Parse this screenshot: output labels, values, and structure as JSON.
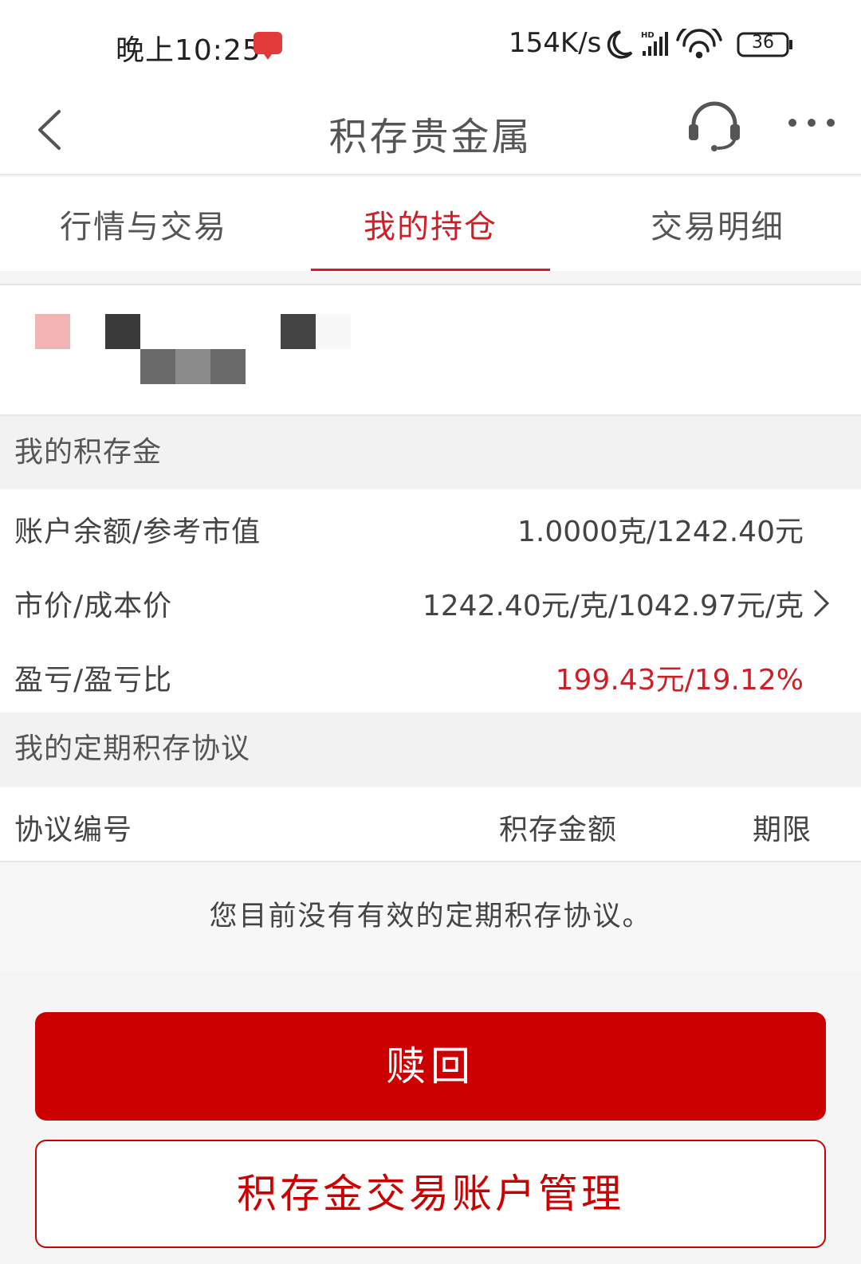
{
  "status_bar": {
    "time": "晚上10:25",
    "network_speed": "154K/s",
    "battery": "36",
    "icons": [
      "app-notification-icon",
      "moon-icon",
      "hd-signal-icon",
      "wifi-icon",
      "battery-icon"
    ]
  },
  "nav": {
    "title": "积存贵金属",
    "icons": [
      "back-icon",
      "headset-icon",
      "more-icon"
    ]
  },
  "tabs": [
    {
      "label": "行情与交易",
      "active": false
    },
    {
      "label": "我的持仓",
      "active": true
    },
    {
      "label": "交易明细",
      "active": false
    }
  ],
  "my_gold": {
    "title": "我的积存金",
    "rows": [
      {
        "label": "账户余额/参考市值",
        "value": "1.0000克/1242.40元"
      },
      {
        "label": "市价/成本价",
        "value": "1242.40元/克/1042.97元/克"
      },
      {
        "label": "盈亏/盈亏比",
        "value": "199.43元/19.12%"
      }
    ]
  },
  "agreements": {
    "title": "我的定期积存协议",
    "columns": [
      "协议编号",
      "积存金额",
      "期限"
    ],
    "empty_message": "您目前没有有效的定期积存协议。"
  },
  "buttons": {
    "redeem": "赎回",
    "manage": "积存金交易账户管理"
  },
  "colors": {
    "accent": "#cc0000",
    "tab_active": "#cf1f26",
    "profit": "#cf1f26"
  }
}
